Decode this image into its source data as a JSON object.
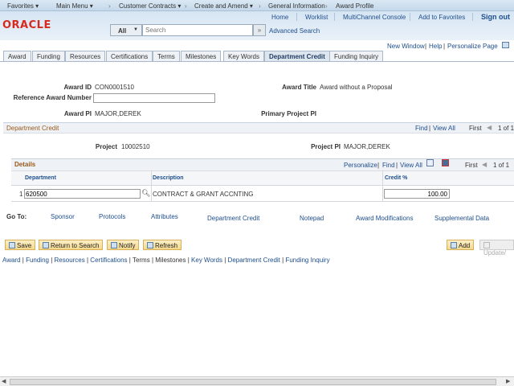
{
  "nav": {
    "favorites": "Favorites ▾",
    "main_menu": "Main Menu ▾",
    "crumbs": [
      "Customer Contracts ▾",
      "Create and Amend ▾",
      "General Information",
      "Award Profile"
    ],
    "sep": "›"
  },
  "header": {
    "logo": "ORACLE",
    "links": [
      "Home",
      "Worklist",
      "MultiChannel Console",
      "Add to Favorites",
      "Sign out"
    ],
    "search_scope": "All",
    "search_placeholder": "Search",
    "search_go": "»",
    "advanced_search": "Advanced Search"
  },
  "toplinks": [
    "New Window",
    "Help",
    "Personalize Page"
  ],
  "tabs": [
    "Award",
    "Funding",
    "Resources",
    "Certifications",
    "Terms",
    "Milestones",
    "Key Words",
    "Department Credit",
    "Funding Inquiry"
  ],
  "active_tab": "Department Credit",
  "form": {
    "award_id_label": "Award ID",
    "award_id": "CON0001510",
    "award_title_label": "Award Title",
    "award_title": "Award without a Proposal",
    "ref_label": "Reference Award Number",
    "ref_value": "",
    "award_pi_label": "Award PI",
    "award_pi": "MAJOR,DEREK",
    "primary_pi_label": "Primary Project PI"
  },
  "dept_credit": {
    "title": "Department Credit",
    "find": "Find",
    "view_all": "View All",
    "first": "First",
    "count": "1 of 1",
    "project_label": "Project",
    "project": "10002510",
    "project_pi_label": "Project PI",
    "project_pi": "MAJOR,DEREK"
  },
  "details": {
    "title": "Details",
    "personalize": "Personalize",
    "find": "Find",
    "view_all": "View All",
    "first": "First",
    "count": "1 of 1",
    "columns": [
      "Department",
      "Description",
      "Credit %"
    ],
    "rows": [
      {
        "num": "1",
        "department": "620500",
        "description": "CONTRACT & GRANT ACCNTING",
        "credit": "100.00"
      }
    ]
  },
  "goto": {
    "label": "Go To:",
    "links": [
      "Sponsor",
      "Protocols",
      "Attributes",
      "Department Credit",
      "Notepad",
      "Award Modifications",
      "Supplemental Data"
    ]
  },
  "buttons": {
    "save": "Save",
    "return": "Return to Search",
    "notify": "Notify",
    "refresh": "Refresh",
    "add": "Add",
    "update": "Update/"
  },
  "bottom_links": [
    "Award",
    "Funding",
    "Resources",
    "Certifications",
    "Terms",
    "Milestones",
    "Key Words",
    "Department Credit",
    "Funding Inquiry"
  ]
}
